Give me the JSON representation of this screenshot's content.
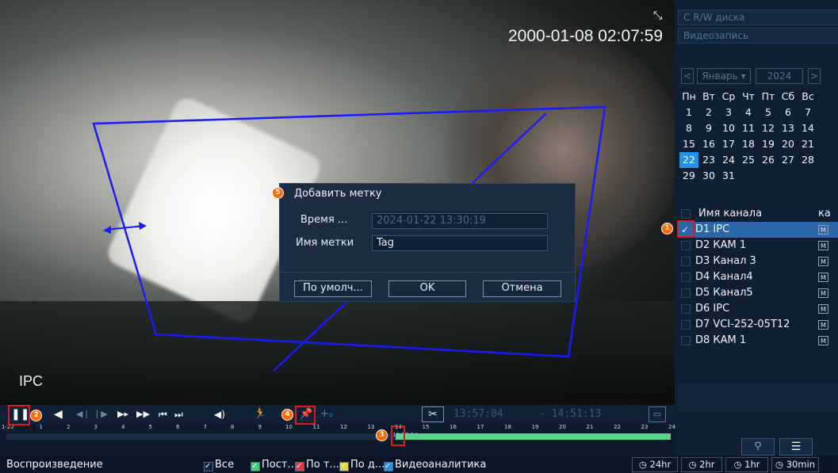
{
  "video": {
    "timestamp": "2000-01-08 02:07:59",
    "camera_label": "IPC",
    "fullscreen_icon": "fullscreen-icon",
    "overlay_color": "#1a1aff"
  },
  "dialog": {
    "badge": "5",
    "title": "Добавить метку",
    "time_label": "Время ...",
    "time_value": "2024-01-22 13:30:19",
    "name_label": "Имя метки",
    "name_value": "Tag",
    "default_button": "По умолч...",
    "ok_button": "OK",
    "cancel_button": "Отмена"
  },
  "markers": {
    "m1": "1",
    "m2": "2",
    "m3": "3",
    "m4": "4"
  },
  "right_panel": {
    "disk_select": "С R/W диска",
    "type_select": "Видеозапись",
    "calendar": {
      "prev": "<",
      "month": "Январь ▾",
      "year": "2024",
      "next": ">",
      "weekdays": [
        "Пн",
        "Вт",
        "Ср",
        "Чт",
        "Пт",
        "Сб",
        "Вс"
      ],
      "weeks": [
        [
          "1",
          "2",
          "3",
          "4",
          "5",
          "6",
          "7"
        ],
        [
          "8",
          "9",
          "10",
          "11",
          "12",
          "13",
          "14"
        ],
        [
          "15",
          "16",
          "17",
          "18",
          "19",
          "20",
          "21"
        ],
        [
          "22",
          "23",
          "24",
          "25",
          "26",
          "27",
          "28"
        ],
        [
          "29",
          "30",
          "31",
          "",
          "",
          "",
          ""
        ]
      ],
      "selected_day": "22"
    },
    "channel_header": "Имя канала",
    "channel_header_2": "ка",
    "channels": [
      {
        "name": "D1 IPC",
        "checked": true
      },
      {
        "name": "D2 КАМ 1",
        "checked": false
      },
      {
        "name": "D3 Канал 3",
        "checked": false
      },
      {
        "name": "D4 Канал4",
        "checked": false
      },
      {
        "name": "D5 Канал5",
        "checked": false
      },
      {
        "name": "D6 IPC",
        "checked": false
      },
      {
        "name": "D7 VCI-252-05T12",
        "checked": false
      },
      {
        "name": "D8 КАМ 1",
        "checked": false
      }
    ],
    "m_badge": "M",
    "search_icon": "search-icon",
    "list_icon": "list-icon"
  },
  "controls": {
    "pause": "❚❚",
    "reverse": "◀",
    "step_back": "◀❘",
    "step_forward": "❘▶",
    "slow": "▶▸",
    "fast": "▶▶",
    "prev_file": "⏮",
    "next_file": "⏭",
    "volume": "◀)",
    "motion": "🏃",
    "tag_add": "📌",
    "tag_custom": "+ₒ",
    "cut": "✂",
    "start_time": "13:57:04",
    "end_time": "- 14:51:13",
    "save": "💾"
  },
  "timeline": {
    "date": "1-22",
    "hours": [
      "1",
      "2",
      "3",
      "4",
      "5",
      "6",
      "7",
      "8",
      "9",
      "10",
      "11",
      "12",
      "13",
      "14",
      "15",
      "16",
      "17",
      "18",
      "19",
      "20",
      "21",
      "22",
      "23",
      "24"
    ],
    "cursor_time": "13:57:04",
    "record_start_hour": 13.95,
    "record_end_hour": 24,
    "green": "#55d68c"
  },
  "bottom_bar": {
    "playback": "Воспроизведение",
    "legend": [
      {
        "label": "Все",
        "color": "#10213a",
        "check": true
      },
      {
        "label": "Пост...",
        "color": "#3bd16f",
        "check": true
      },
      {
        "label": "По т...",
        "color": "#e03a3a",
        "check": true
      },
      {
        "label": "По д...",
        "color": "#e5d43a",
        "check": true
      },
      {
        "label": "Видеоаналитика",
        "color": "#2f8fe0",
        "check": true
      }
    ],
    "zoom": [
      "24hr",
      "2hr",
      "1hr",
      "30min"
    ]
  }
}
